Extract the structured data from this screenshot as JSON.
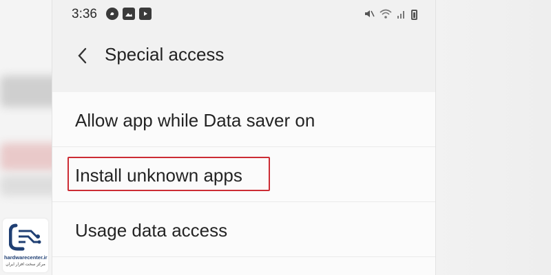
{
  "status_bar": {
    "time": "3:36",
    "left_icons": [
      "whatsapp-icon",
      "gallery-icon",
      "youtube-icon"
    ],
    "right_icons": [
      "mute-icon",
      "wifi-icon",
      "signal-icon",
      "battery-icon"
    ]
  },
  "header": {
    "back_glyph": "‹",
    "title": "Special access"
  },
  "list": {
    "items": [
      {
        "label": "Allow app while Data saver on",
        "highlighted": false
      },
      {
        "label": "Install unknown apps",
        "highlighted": true
      },
      {
        "label": "Usage data access",
        "highlighted": false
      }
    ]
  },
  "colors": {
    "highlight": "#cc2b33",
    "logo_blue": "#1f3f73"
  },
  "watermark": {
    "name": "hardwarecenter.ir",
    "subtitle": "مرکز سخت افزار ایران"
  }
}
